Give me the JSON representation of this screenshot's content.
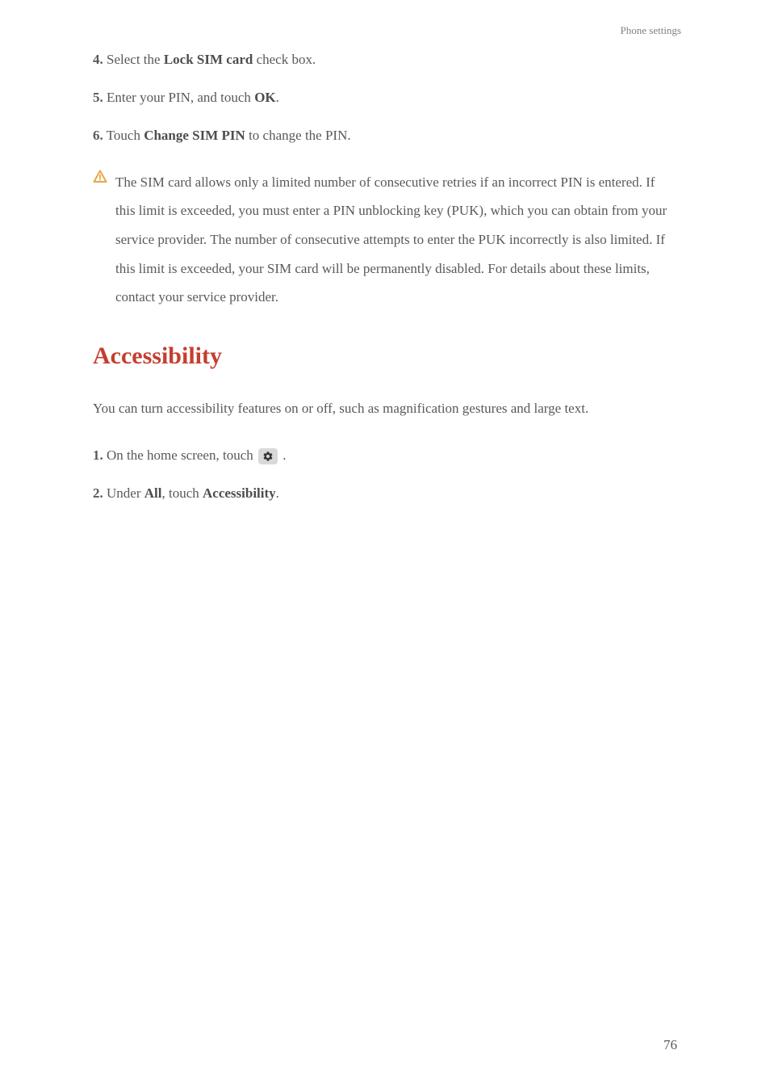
{
  "header": {
    "section_label": "Phone settings"
  },
  "steps": {
    "step4": {
      "num": "4.",
      "text_before": "Select the ",
      "bold": "Lock SIM card",
      "text_after": " check box."
    },
    "step5": {
      "num": "5.",
      "text_before": "Enter your PIN, and touch ",
      "bold": "OK",
      "text_after": "."
    },
    "step6": {
      "num": "6.",
      "text_before": "Touch ",
      "bold": "Change SIM PIN",
      "text_after": " to change the PIN."
    }
  },
  "warning": {
    "text": "The SIM card allows only a limited number of consecutive retries if an incorrect PIN is entered. If this limit is exceeded, you must enter a PIN unblocking key (PUK), which you can obtain from your service provider. The number of consecutive attempts to enter the PUK incorrectly is also limited. If this limit is exceeded, your SIM card will be permanently disabled. For details about these limits, contact your service provider."
  },
  "accessibility": {
    "heading": "Accessibility",
    "intro": "You can turn accessibility features on or off, such as magnification gestures and large text.",
    "step1": {
      "num": "1.",
      "text_before": "On the home screen, touch ",
      "text_after": "."
    },
    "step2": {
      "num": "2.",
      "text_before": "Under ",
      "bold1": "All",
      "text_mid": ", touch ",
      "bold2": "Accessibility",
      "text_after": "."
    }
  },
  "page_number": "76"
}
